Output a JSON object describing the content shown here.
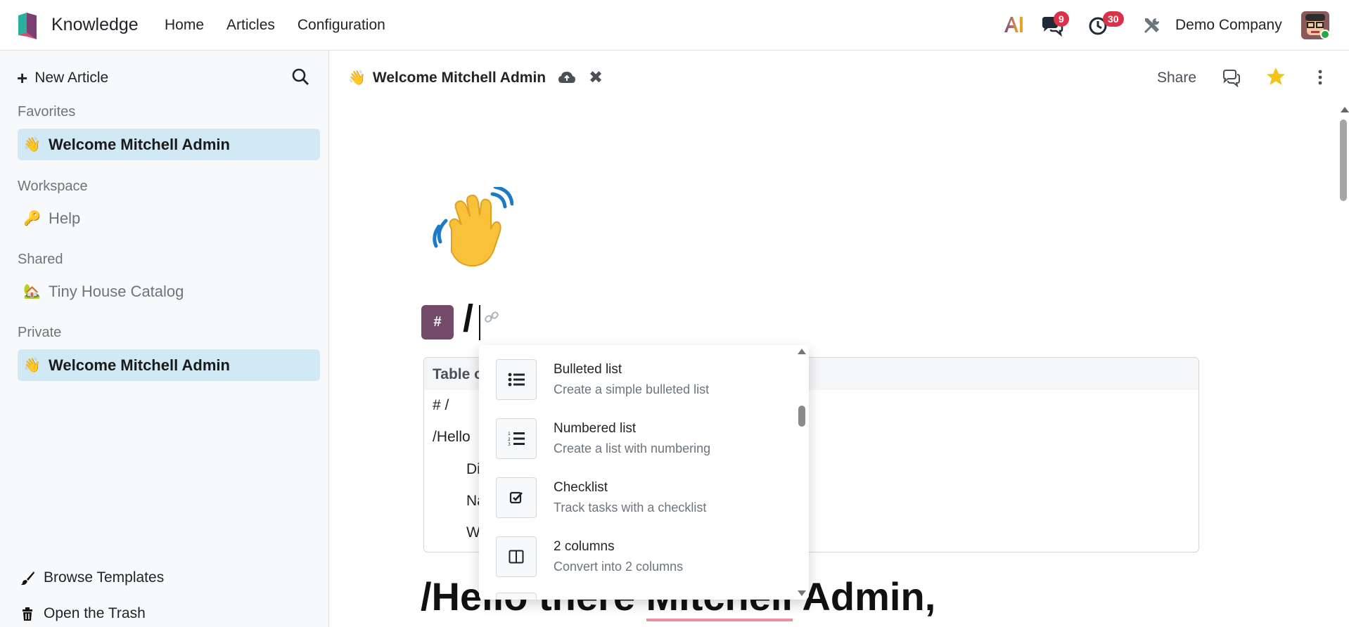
{
  "navbar": {
    "app_name": "Knowledge",
    "menu": [
      "Home",
      "Articles",
      "Configuration"
    ],
    "chat_badge": "9",
    "activity_badge": "30",
    "company": "Demo Company"
  },
  "sidebar": {
    "new_article": "New Article",
    "sections": {
      "favorites": "Favorites",
      "workspace": "Workspace",
      "shared": "Shared",
      "private": "Private"
    },
    "favorites_items": [
      {
        "emoji": "👋",
        "label": "Welcome Mitchell Admin"
      }
    ],
    "workspace_items": [
      {
        "emoji": "🔑",
        "label": "Help"
      }
    ],
    "shared_items": [
      {
        "emoji": "🏡",
        "label": "Tiny House Catalog"
      }
    ],
    "private_items": [
      {
        "emoji": "👋",
        "label": "Welcome Mitchell Admin"
      }
    ],
    "browse_templates": "Browse Templates",
    "open_trash": "Open the Trash"
  },
  "article": {
    "emoji": "👋",
    "title": "Welcome Mitchell Admin",
    "share_label": "Share",
    "hash_label": "#",
    "heading_text": "/",
    "toc_title": "Table o",
    "toc_items": [
      "# /",
      "/Hello",
      "Di",
      "Na",
      "W"
    ],
    "hello_before": "/Hello there ",
    "hello_underlined": "Mitchell",
    "hello_after": " Admin,"
  },
  "command_menu": {
    "items": [
      {
        "icon": "bulleted-list-icon",
        "title": "Bulleted list",
        "desc": "Create a simple bulleted list"
      },
      {
        "icon": "numbered-list-icon",
        "title": "Numbered list",
        "desc": "Create a list with numbering"
      },
      {
        "icon": "checklist-icon",
        "title": "Checklist",
        "desc": "Track tasks with a checklist"
      },
      {
        "icon": "columns-icon",
        "title": "2 columns",
        "desc": "Convert into 2 columns"
      }
    ]
  },
  "colors": {
    "brand": "#714b67",
    "active_item_bg": "#d0e9f5",
    "badge": "#d9334b",
    "star": "#f3c318"
  }
}
